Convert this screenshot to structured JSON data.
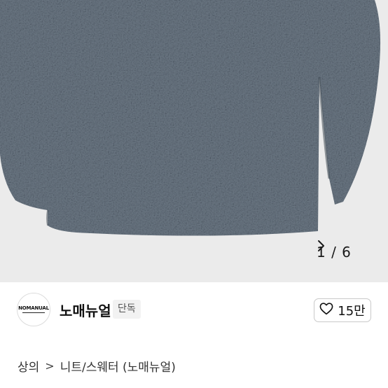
{
  "gallery": {
    "image_alt": "product-photo-sweater",
    "pager_current": "1",
    "pager_total": "6",
    "pager_text": "1 / 6",
    "colors": {
      "background": "#ebebeb",
      "knit_dark": "#4f5b67",
      "knit_light": "#8a949e"
    }
  },
  "seller": {
    "logo_text": "NOMANUAL",
    "name": "노매뉴얼",
    "badge": "단독",
    "likes": "15만"
  },
  "breadcrumb": {
    "items": [
      "상의",
      "니트/스웨터 (노매뉴얼)"
    ],
    "separator": ">"
  }
}
